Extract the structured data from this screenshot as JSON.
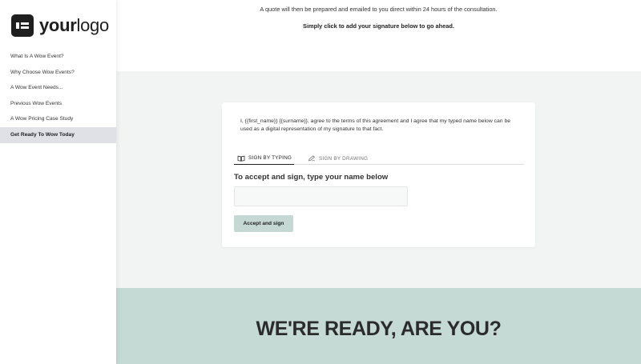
{
  "logo": {
    "bold": "your",
    "light": "logo"
  },
  "sidebar": {
    "items": [
      {
        "label": "What Is A Wow Event?"
      },
      {
        "label": "Why Choose Wow Events?"
      },
      {
        "label": "A Wow Event Needs..."
      },
      {
        "label": "Previous Wow Events"
      },
      {
        "label": "A Wow Pricing Case Study"
      },
      {
        "label": "Get Ready To Wow Today",
        "active": true
      }
    ]
  },
  "intro": {
    "line1": "A quote will then be prepared and emailed to you direct within 24 hours of the consultation.",
    "line2": "Simply click to add your signature below to go ahead."
  },
  "signature": {
    "agreement": "I, {{first_name}} {{surname}}, agree to the terms of this agreement and I agree that my typed name below can be used as a digital representation of my signature to that fact.",
    "tabs": [
      {
        "label": "SIGN BY TYPING",
        "icon": "book-icon",
        "active": true
      },
      {
        "label": "SIGN BY DRAWING",
        "icon": "pen-icon",
        "active": false
      }
    ],
    "heading": "To accept and sign, type your name below",
    "input_value": "",
    "input_placeholder": "",
    "button_label": "Accept and sign"
  },
  "ready": {
    "title": "WE'RE READY, ARE YOU?"
  },
  "colors": {
    "sign_section_bg": "#f1f4f2",
    "ready_section_bg": "#c5d9d5",
    "button_bg": "#c6d8d4",
    "nav_active_bg": "#dfe1e6"
  }
}
